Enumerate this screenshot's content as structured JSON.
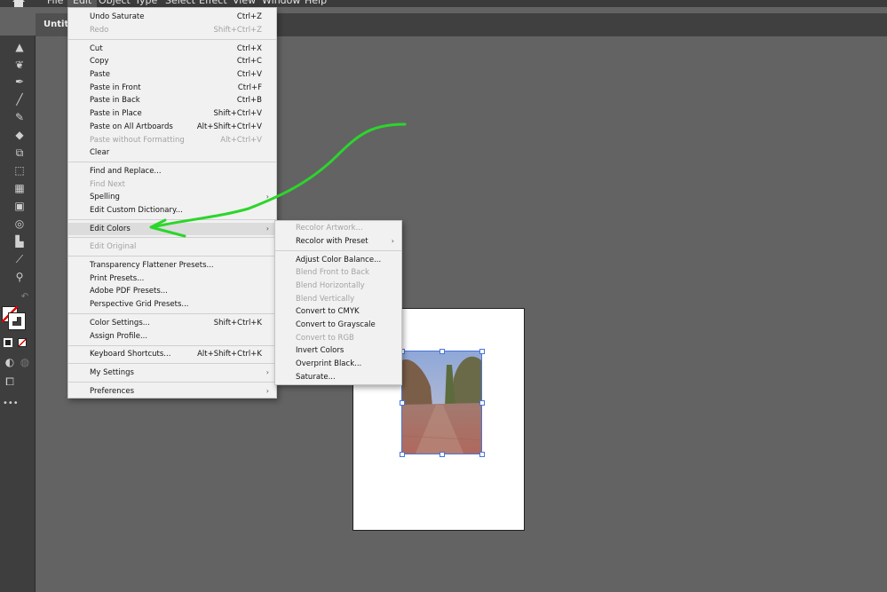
{
  "menubar": {
    "items": [
      "File",
      "Edit",
      "Object",
      "Type",
      "Select",
      "Effect",
      "View",
      "Window",
      "Help"
    ]
  },
  "tab": {
    "title": "Untitle"
  },
  "edit_menu": {
    "undo": {
      "label": "Undo Saturate",
      "shortcut": "Ctrl+Z"
    },
    "redo": {
      "label": "Redo",
      "shortcut": "Shift+Ctrl+Z"
    },
    "cut": {
      "label": "Cut",
      "shortcut": "Ctrl+X"
    },
    "copy": {
      "label": "Copy",
      "shortcut": "Ctrl+C"
    },
    "paste": {
      "label": "Paste",
      "shortcut": "Ctrl+V"
    },
    "paste_front": {
      "label": "Paste in Front",
      "shortcut": "Ctrl+F"
    },
    "paste_back": {
      "label": "Paste in Back",
      "shortcut": "Ctrl+B"
    },
    "paste_place": {
      "label": "Paste in Place",
      "shortcut": "Shift+Ctrl+V"
    },
    "paste_all": {
      "label": "Paste on All Artboards",
      "shortcut": "Alt+Shift+Ctrl+V"
    },
    "paste_noformat": {
      "label": "Paste without Formatting",
      "shortcut": "Alt+Ctrl+V"
    },
    "clear": {
      "label": "Clear"
    },
    "find_replace": {
      "label": "Find and Replace..."
    },
    "find_next": {
      "label": "Find Next"
    },
    "spelling": {
      "label": "Spelling"
    },
    "edit_dictionary": {
      "label": "Edit Custom Dictionary..."
    },
    "edit_colors": {
      "label": "Edit Colors"
    },
    "edit_original": {
      "label": "Edit Original"
    },
    "transparency": {
      "label": "Transparency Flattener Presets..."
    },
    "print_presets": {
      "label": "Print Presets..."
    },
    "pdf_presets": {
      "label": "Adobe PDF Presets..."
    },
    "perspective": {
      "label": "Perspective Grid Presets..."
    },
    "color_settings": {
      "label": "Color Settings...",
      "shortcut": "Shift+Ctrl+K"
    },
    "assign_profile": {
      "label": "Assign Profile..."
    },
    "keyboard": {
      "label": "Keyboard Shortcuts...",
      "shortcut": "Alt+Shift+Ctrl+K"
    },
    "my_settings": {
      "label": "My Settings"
    },
    "preferences": {
      "label": "Preferences"
    }
  },
  "edit_colors_submenu": {
    "recolor_artwork": "Recolor Artwork...",
    "recolor_preset": "Recolor with Preset",
    "adjust_balance": "Adjust Color Balance...",
    "blend_front_back": "Blend Front to Back",
    "blend_horizontal": "Blend Horizontally",
    "blend_vertical": "Blend Vertically",
    "convert_cmyk": "Convert to CMYK",
    "convert_grayscale": "Convert to Grayscale",
    "convert_rgb": "Convert to RGB",
    "invert": "Invert Colors",
    "overprint": "Overprint Black...",
    "saturate": "Saturate..."
  },
  "colors": {
    "menu_bg": "#f1f1f1",
    "menu_highlight": "#dcdcdc",
    "disabled_text": "#a3a3a3",
    "canvas": "#636363",
    "selection": "#4a74d8",
    "annotation": "#2bd62b"
  }
}
